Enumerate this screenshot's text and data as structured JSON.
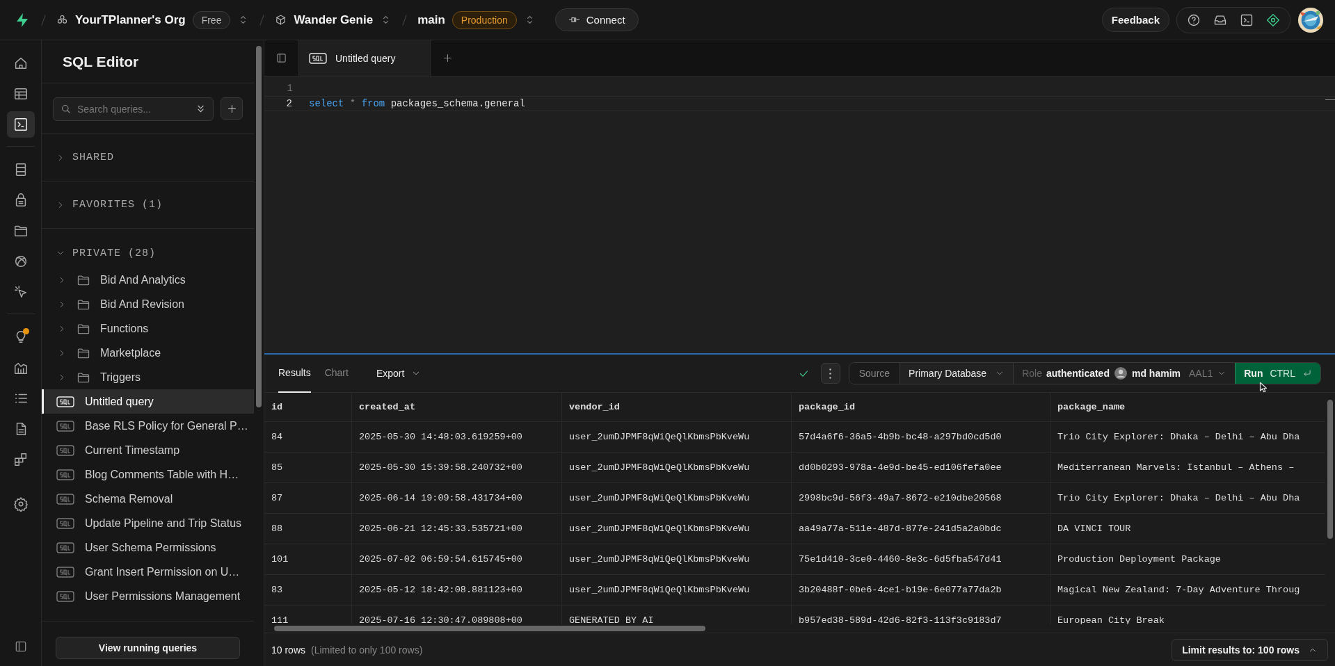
{
  "top_bar": {
    "org": "YourTPlanner's Org",
    "plan": "Free",
    "project": "Wander Genie",
    "branch": "main",
    "environment": "Production",
    "connect": "Connect",
    "feedback": "Feedback"
  },
  "rail": [
    [
      {
        "selected": false,
        "notification": false
      },
      {
        "selected": false,
        "notification": false
      },
      {
        "selected": true,
        "notification": false
      }
    ],
    [
      {
        "selected": false,
        "notification": false
      },
      {
        "selected": false,
        "notification": false
      },
      {
        "selected": false,
        "notification": false
      },
      {
        "selected": false,
        "notification": false
      },
      {
        "selected": false,
        "notification": false
      }
    ],
    [
      {
        "selected": false,
        "notification": true
      },
      {
        "selected": false,
        "notification": false
      },
      {
        "selected": false,
        "notification": false
      },
      {
        "selected": false,
        "notification": false
      },
      {
        "selected": false,
        "notification": false
      }
    ],
    [
      {
        "selected": false,
        "notification": false
      }
    ]
  ],
  "sidebar": {
    "title": "SQL Editor",
    "search": {
      "placeholder": "Search queries..."
    },
    "sections": [
      {
        "label": "SHARED",
        "expanded": false
      },
      {
        "label": "FAVORITES (1)",
        "expanded": false
      },
      {
        "label": "PRIVATE (28)",
        "expanded": true,
        "items": [
          {
            "kind": "folder",
            "label": "Bid And Analytics",
            "expanded": false
          },
          {
            "kind": "folder",
            "label": "Bid And Revision",
            "expanded": false
          },
          {
            "kind": "folder",
            "label": "Functions",
            "expanded": false
          },
          {
            "kind": "folder",
            "label": "Marketplace",
            "expanded": false
          },
          {
            "kind": "folder",
            "label": "Triggers",
            "expanded": false
          },
          {
            "kind": "query",
            "label": "Untitled query",
            "selected": true
          },
          {
            "kind": "query",
            "label": "Base RLS Policy for General P…",
            "selected": false
          },
          {
            "kind": "query",
            "label": "Current Timestamp",
            "selected": false
          },
          {
            "kind": "query",
            "label": "Blog Comments Table with H…",
            "selected": false
          },
          {
            "kind": "query",
            "label": "Schema Removal",
            "selected": false
          },
          {
            "kind": "query",
            "label": "Update Pipeline and Trip Status",
            "selected": false
          },
          {
            "kind": "query",
            "label": "User Schema Permissions",
            "selected": false
          },
          {
            "kind": "query",
            "label": "Grant Insert Permission on U…",
            "selected": false
          },
          {
            "kind": "query",
            "label": "User Permissions Management",
            "selected": false
          }
        ]
      }
    ],
    "footer_button": "View running queries"
  },
  "editor_tabs": [
    {
      "label": "Untitled query",
      "selected": true
    }
  ],
  "editor": {
    "lines": [
      {
        "number": "1"
      },
      {
        "number": "2",
        "tokens": [
          {
            "kind": "keyword",
            "text": "select"
          },
          {
            "kind": "operator",
            "text": "*"
          },
          {
            "kind": "keyword",
            "text": "from"
          },
          {
            "kind": "plain",
            "text": "packages_schema.general"
          }
        ]
      }
    ]
  },
  "results": {
    "tabs": [
      {
        "label": "Results",
        "selected": true
      },
      {
        "label": "Chart",
        "selected": false
      }
    ],
    "export": "Export",
    "source_label": "Source",
    "source": "Primary Database",
    "role_label": "Role",
    "role": "authenticated",
    "user": "md hamim",
    "aal": "AAL1",
    "run": "Run",
    "run_shortcut": "CTRL",
    "table": {
      "columns": [
        "id",
        "created_at",
        "vendor_id",
        "package_id",
        "package_name"
      ],
      "rows": [
        [
          "84",
          "2025-05-30 14:48:03.619259+00",
          "user_2umDJPMF8qWiQeQlKbmsPbKveWu",
          "57d4a6f6-36a5-4b9b-bc48-a297bd0cd5d0",
          "Trio City Explorer: Dhaka – Delhi – Abu Dha"
        ],
        [
          "85",
          "2025-05-30 15:39:58.240732+00",
          "user_2umDJPMF8qWiQeQlKbmsPbKveWu",
          "dd0b0293-978a-4e9d-be45-ed106fefa0ee",
          "Mediterranean Marvels: Istanbul – Athens –"
        ],
        [
          "87",
          "2025-06-14 19:09:58.431734+00",
          "user_2umDJPMF8qWiQeQlKbmsPbKveWu",
          "2998bc9d-56f3-49a7-8672-e210dbe20568",
          "Trio City Explorer: Dhaka – Delhi – Abu Dha"
        ],
        [
          "88",
          "2025-06-21 12:45:33.535721+00",
          "user_2umDJPMF8qWiQeQlKbmsPbKveWu",
          "aa49a77a-511e-487d-877e-241d5a2a0bdc",
          "DA VINCI TOUR"
        ],
        [
          "101",
          "2025-07-02 06:59:54.615745+00",
          "user_2umDJPMF8qWiQeQlKbmsPbKveWu",
          "75e1d410-3ce0-4460-8e3c-6d5fba547d41",
          "Production Deployment Package"
        ],
        [
          "83",
          "2025-05-12 18:42:08.881123+00",
          "user_2umDJPMF8qWiQeQlKbmsPbKveWu",
          "3b20488f-0be6-4ce1-b19e-6e077a77da2b",
          "Magical New Zealand: 7-Day Adventure Throug"
        ],
        [
          "111",
          "2025-07-16 12:30:47.089808+00",
          "GENERATED BY AI",
          "b957ed38-589d-42d6-82f3-113f3c9183d7",
          "European City Break"
        ]
      ]
    },
    "row_count": "10 rows",
    "row_note": "(Limited to only 100 rows)",
    "limit": "Limit results to: 100 rows"
  }
}
